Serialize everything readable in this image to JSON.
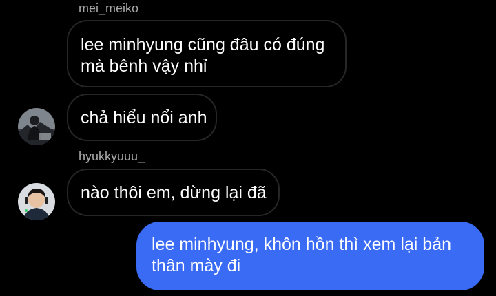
{
  "messages": [
    {
      "sender": "mei_meiko",
      "lines": [
        "lee minhyung cũng đâu có đúng",
        "mà bênh vậy nhỉ"
      ]
    },
    {
      "avatar": "avatar-1",
      "lines": [
        "chả hiểu nổi anh"
      ]
    },
    {
      "sender": "hyukkyuuu_",
      "avatar": "avatar-2",
      "lines": [
        "nào thôi em, dừng lại đã"
      ]
    },
    {
      "outgoing": true,
      "lines": [
        "lee minhyung, khôn hồn thì xem lại bản",
        "thân mày đi"
      ]
    }
  ],
  "colors": {
    "background": "#000000",
    "incoming_border": "#262626",
    "outgoing_bubble": "#3a6bf5",
    "sender_text": "#a8a8a8"
  }
}
